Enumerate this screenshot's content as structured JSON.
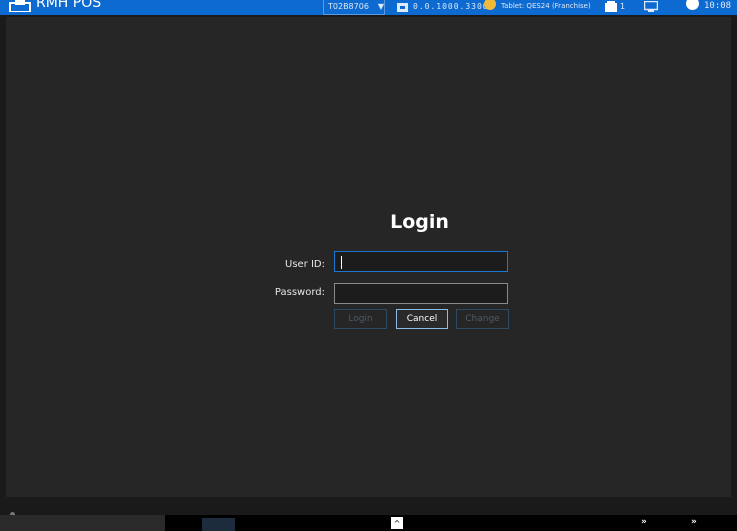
{
  "topbar": {
    "app_title": "RMH POS",
    "terminal": "T02B8706",
    "ip": "0.0.1000.33001",
    "user": "Tablet: QES24 (Franchise)",
    "cart_count": "1",
    "clock": "10:08"
  },
  "login": {
    "title": "Login",
    "userid_label": "User ID:",
    "password_label": "Password:",
    "userid_value": "",
    "password_value": "",
    "login_label": "Login",
    "cancel_label": "Cancel",
    "change_label": "Change"
  },
  "bottom": {
    "scroll_up": "^",
    "chev_1": "»",
    "chev_2": "»"
  },
  "colors": {
    "accent": "#0d6ad1",
    "background": "#262626",
    "focus_border": "#1a78d0"
  }
}
